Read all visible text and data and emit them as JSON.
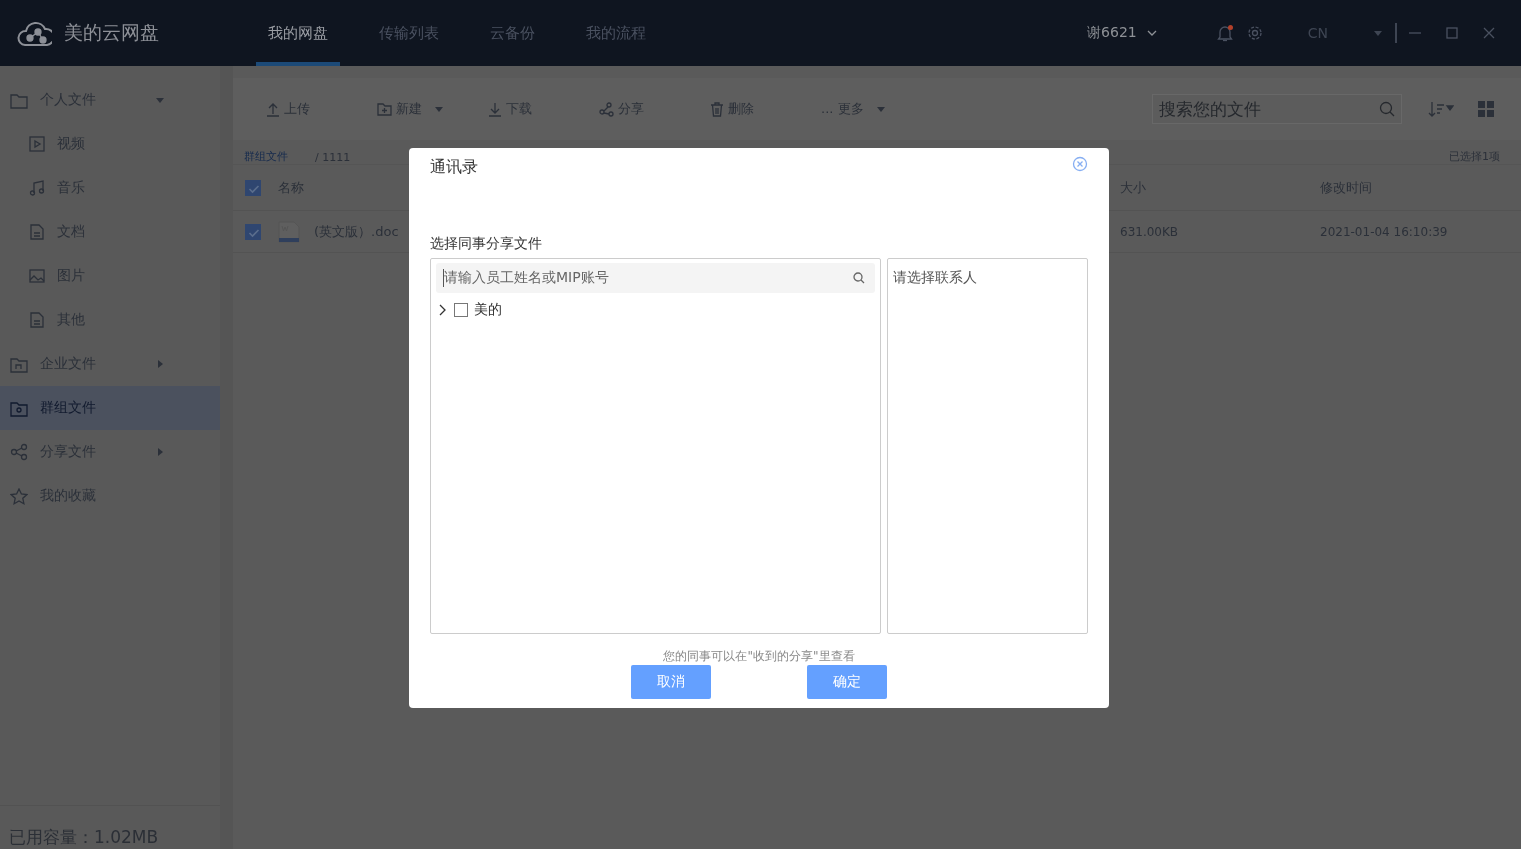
{
  "app": {
    "name": "美的云网盘"
  },
  "nav_tabs": [
    {
      "label": "我的网盘",
      "selected": true
    },
    {
      "label": "传输列表",
      "selected": false
    },
    {
      "label": "云备份",
      "selected": false
    },
    {
      "label": "我的流程",
      "selected": false
    }
  ],
  "user": {
    "name": "谢6621"
  },
  "notifications": {
    "unread": true
  },
  "language": "CN",
  "sidebar": {
    "items": [
      {
        "label": "个人文件",
        "kind": "folder",
        "expanded": true,
        "selected": false,
        "children": [
          {
            "label": "视频",
            "kind": "video",
            "selected": false
          },
          {
            "label": "音乐",
            "kind": "music",
            "selected": false
          },
          {
            "label": "文档",
            "kind": "document",
            "selected": false
          },
          {
            "label": "图片",
            "kind": "image",
            "selected": false
          },
          {
            "label": "其他",
            "kind": "document",
            "selected": false
          }
        ]
      },
      {
        "label": "企业文件",
        "kind": "company",
        "expanded": false,
        "selected": false
      },
      {
        "label": "群组文件",
        "kind": "group",
        "selected": true
      },
      {
        "label": "分享文件",
        "kind": "share",
        "expanded": false,
        "selected": false
      },
      {
        "label": "我的收藏",
        "kind": "star",
        "selected": false
      }
    ],
    "storage": "已用容量：1.02MB"
  },
  "toolbar": {
    "buttons": [
      {
        "label": "上传",
        "kind": "upload",
        "dropdown": false
      },
      {
        "label": "新建",
        "kind": "new",
        "dropdown": true
      },
      {
        "label": "下载",
        "kind": "download",
        "dropdown": false
      },
      {
        "label": "分享",
        "kind": "share",
        "dropdown": false
      },
      {
        "label": "删除",
        "kind": "delete",
        "dropdown": false
      },
      {
        "label": "... 更多",
        "kind": "more",
        "dropdown": true
      }
    ]
  },
  "search": {
    "placeholder": "搜索您的文件"
  },
  "breadcrumb": [
    "群组文件",
    "/ 1111"
  ],
  "selection_count": "已选择1项",
  "table": {
    "columns": [
      "名称",
      "大小",
      "修改时间"
    ],
    "all_checked": true,
    "rows": [
      {
        "name": "(英文版）.doc",
        "size": "631.00KB",
        "modified": "2021-01-04 16:10:39",
        "checked": true
      }
    ]
  },
  "dialog": {
    "title": "通讯录",
    "label": "选择同事分享文件",
    "search_placeholder": "请输入员工姓名或MIP账号",
    "tree": [
      {
        "label": "美的",
        "checked": false,
        "expanded": false
      }
    ],
    "selected_placeholder": "请选择联系人",
    "hint": "您的同事可以在\"收到的分享\"里查看",
    "buttons": [
      {
        "label": "取消"
      },
      {
        "label": "确定"
      }
    ]
  }
}
